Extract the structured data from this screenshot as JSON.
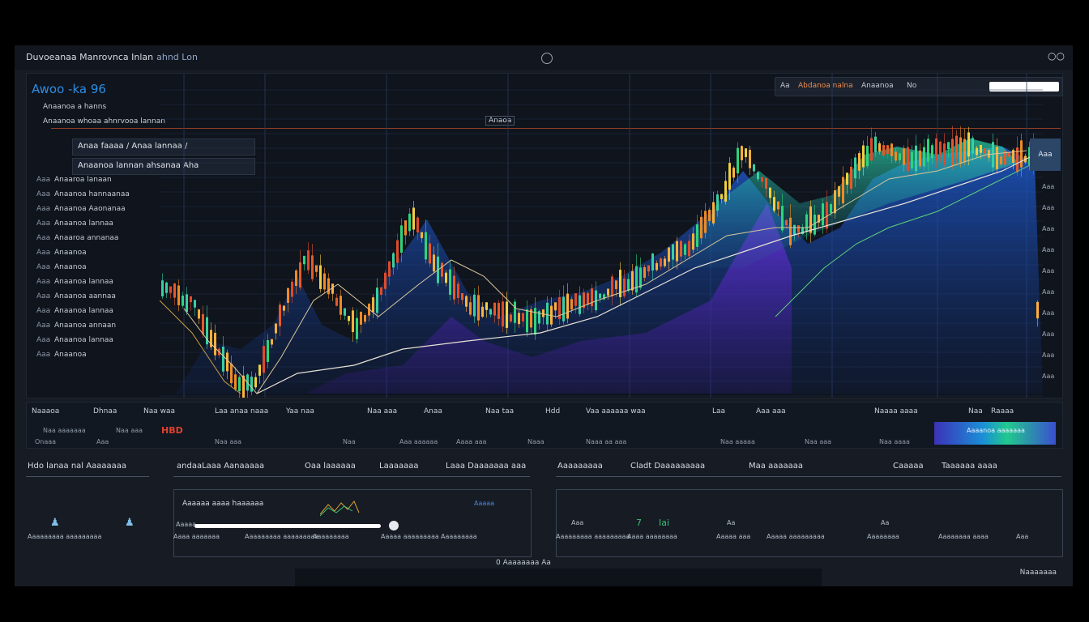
{
  "window": {
    "title": "Duvoeanaa Manrovnca Inlan",
    "title_extra": "ahnd Lon",
    "close_label": "○○"
  },
  "header": {
    "app_title": "Awoo -ka 96",
    "sub1": "Anaanoa a hanns",
    "sub2": "Anaanoa whoaa ahnrvooa lannan",
    "center_tag": "Anaoa",
    "search_items": [
      "Abdanoa nalna",
      "Anaanoa",
      "No",
      "Aa"
    ],
    "search_placeholder": "",
    "overlay1": "Anaa faaaa  /  Anaa lannaa /",
    "overlay2": "Anaanoa lannan ahsanaa Aha",
    "right_tag": "Aaa"
  },
  "rows": [
    {
      "n": "Aaa",
      "l": "Anaaroa lanaan"
    },
    {
      "n": "Aaa",
      "l": "Anaanoa hannaanaa"
    },
    {
      "n": "Aaa",
      "l": "Anaanoa Aaonanaa"
    },
    {
      "n": "Aaa",
      "l": "Anaanoa lannaa"
    },
    {
      "n": "Aaa",
      "l": "Anaaroa annanaa"
    },
    {
      "n": "Aaa",
      "l": "Anaanoa"
    },
    {
      "n": "Aaa",
      "l": "Anaanoa"
    },
    {
      "n": "Aaa",
      "l": "Anaanoa lannaa"
    },
    {
      "n": "Aaa",
      "l": "Anaanoa aannaa"
    },
    {
      "n": "Aaa",
      "l": "Anaanoa lannaa"
    },
    {
      "n": "Aaa",
      "l": "Anaanoa annaan"
    },
    {
      "n": "Aaa",
      "l": "Anaanoa lannaa"
    },
    {
      "n": "Aaa",
      "l": "Anaanoa"
    }
  ],
  "right_axis": [
    "Aaa",
    "Aaa",
    "Aaa",
    "Aaa",
    "Aaa",
    "Aaa",
    "Aaa",
    "Aaa",
    "Aaa",
    "Aaa"
  ],
  "strip": {
    "headers": [
      "Naaaoa",
      "Dhnaa",
      "Naa waa",
      "Laa anaa naaa",
      "Yaa naa",
      "Naa aaa",
      "Anaa",
      "Naa taa",
      "Hdd",
      "Vaa aaaaaa waa",
      "Laa",
      "Aaa aaa",
      "Naaaa aaaa",
      "Naa",
      "Raaaa"
    ],
    "red_tag": "HBD",
    "vals": [
      "Onaaa",
      "Aaa",
      "Naa aaa",
      "Naa",
      "Aaa aaaaaa",
      "Aaaa aaa",
      "Naaa",
      "Naaa aa aaa",
      "Naa aaaaa",
      "Naa aaa",
      "Naa aaaa",
      "Naa aaaaaaa",
      "Naa aaa"
    ],
    "blue_label": "Aaaanoa aaaaaaa"
  },
  "lower": {
    "headers": [
      "Hdo  lanaa  nal Aaaaaaaa",
      "andaaLaaa Aanaaaaa",
      "Oaa laaaaaa",
      "Laaaaaaa",
      "Laaa Daaaaaaa aaa",
      "Aaaaaaaaa",
      "Cladt Daaaaaaaaa",
      "Maa aaaaaaa",
      "Caaaaa",
      "Taaaaaa aaaa"
    ],
    "boxA_title": "Aaaaaa aaaa haaaaaa",
    "boxA_label": "Aaaaa",
    "boxB_values": [
      "Aaa",
      "7",
      "Iai",
      "Aa",
      "Aa"
    ],
    "labels": [
      "Aaaaaaaaa aaaaaaaaa",
      "Aaaa aaaaaaa",
      "Aaaaaaaaa aaaaaaaaa",
      "Aaaaaaaaa",
      "Aaaaa aaaaaaaaa",
      "Aaaaaaaaa",
      "Aaaaaaaaa aaaaaaaaa",
      "Aaaa aaaaaaaa",
      "Aaaaa aaa",
      "Aaaaa aaaaaaaaa",
      "Aaaaaaaa",
      "Aaaaaaaa aaaa",
      "Aaa"
    ],
    "blue_tag": "Aaaaa"
  },
  "footer": {
    "status": "0  Aaaaaaaa  Aa",
    "right": "Naaaaaaa"
  },
  "colors": {
    "accent": "#2f8ce0",
    "alert": "#e0402e",
    "panel": "#0f141d"
  }
}
